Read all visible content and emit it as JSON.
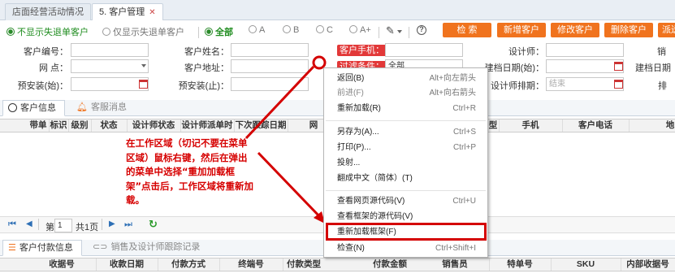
{
  "tabs": [
    {
      "label": "店面经营活动情况",
      "closable": false
    },
    {
      "label": "5. 客户管理",
      "closable": true
    }
  ],
  "filters": {
    "radio_no_lost": "不显示失退单客户",
    "radio_only_lost": "仅显示失退单客户",
    "grade_all": "全部",
    "grade_a": "A",
    "grade_b": "B",
    "grade_c": "C",
    "grade_aplus": "A+"
  },
  "toolbar": {
    "search": "检 索",
    "add": "新增客户",
    "edit": "修改客户",
    "delete": "删除客户",
    "dispatch": "派送"
  },
  "form": {
    "customer_no": "客户编号：",
    "customer_name": "客户姓名：",
    "customer_phone": "客户手机：",
    "designer": "设计师：",
    "sales": "销",
    "store": "网 点：",
    "address": "客户地址：",
    "filter_cond": "过滤条件：",
    "filter_value": "全部",
    "file_date_start": "建档日期(始)：",
    "file_date_end": "建档日期",
    "install_start": "预安装(始)：",
    "install_end": "预安装(止)：",
    "designer_schedule": "设计师排期：",
    "schedule_end_placeholder": "结束",
    "rank": "排"
  },
  "section_tabs": {
    "customer_info": "客户信息",
    "service_msg": "客服消息",
    "payment_info": "客户付款信息",
    "followup": "销售及设计师跟踪记录"
  },
  "table1_headers": [
    "带单",
    "标识",
    "级别",
    "状态",
    "设计师状态",
    "设计师派单时",
    "下次跟踪日期",
    "网",
    "型",
    "手机",
    "客户电话",
    "地"
  ],
  "table2_headers": [
    "收据号",
    "收款日期",
    "付款方式",
    "终端号",
    "付款类型",
    "付款金额",
    "销售员",
    "特单号",
    "SKU",
    "内部收据号"
  ],
  "pager": {
    "page_label": "第",
    "page_value": "1",
    "total_label": "共1页"
  },
  "context_menu": [
    {
      "label": "返回(B)",
      "shortcut": "Alt+向左箭头",
      "disabled": false
    },
    {
      "label": "前进(F)",
      "shortcut": "Alt+向右箭头",
      "disabled": true
    },
    {
      "label": "重新加载(R)",
      "shortcut": "Ctrl+R",
      "disabled": false
    },
    {
      "label": "另存为(A)...",
      "shortcut": "Ctrl+S",
      "disabled": false
    },
    {
      "label": "打印(P)...",
      "shortcut": "Ctrl+P",
      "disabled": false
    },
    {
      "label": "投射...",
      "shortcut": "",
      "disabled": false
    },
    {
      "label": "翻成中文（简体）(T)",
      "shortcut": "",
      "disabled": false
    },
    {
      "label": "查看网页源代码(V)",
      "shortcut": "Ctrl+U",
      "disabled": false
    },
    {
      "label": "查看框架的源代码(V)",
      "shortcut": "",
      "disabled": false
    },
    {
      "label": "重新加载框架(F)",
      "shortcut": "",
      "disabled": false
    },
    {
      "label": "检查(N)",
      "shortcut": "Ctrl+Shift+I",
      "disabled": false
    }
  ],
  "annotation": "在工作区域（切记不要在菜单区域）鼠标右键，然后在弹出的菜单中选择“重加加载框架”点击后，工作区域将重新加载。",
  "colors": {
    "accent": "#f0731e",
    "annotation": "#d60000",
    "active_radio": "#1f8c1f"
  }
}
